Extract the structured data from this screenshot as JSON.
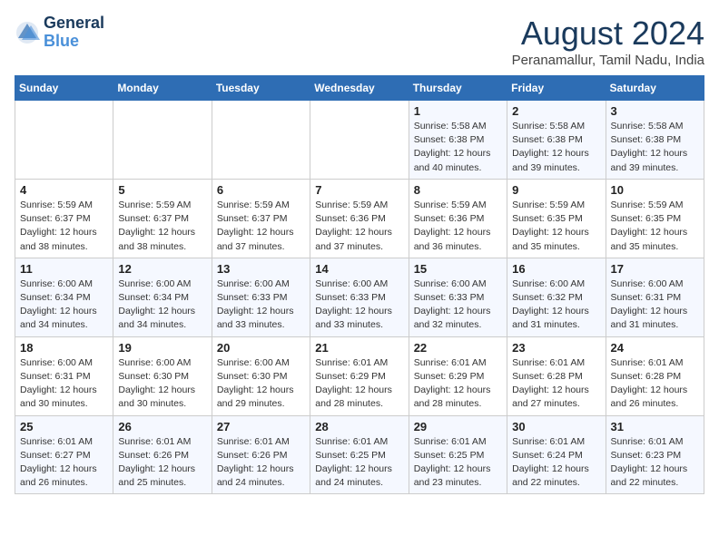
{
  "header": {
    "logo_line1": "General",
    "logo_line2": "Blue",
    "month_year": "August 2024",
    "location": "Peranamallur, Tamil Nadu, India"
  },
  "days_of_week": [
    "Sunday",
    "Monday",
    "Tuesday",
    "Wednesday",
    "Thursday",
    "Friday",
    "Saturday"
  ],
  "weeks": [
    [
      {
        "day": "",
        "info": ""
      },
      {
        "day": "",
        "info": ""
      },
      {
        "day": "",
        "info": ""
      },
      {
        "day": "",
        "info": ""
      },
      {
        "day": "1",
        "info": "Sunrise: 5:58 AM\nSunset: 6:38 PM\nDaylight: 12 hours\nand 40 minutes."
      },
      {
        "day": "2",
        "info": "Sunrise: 5:58 AM\nSunset: 6:38 PM\nDaylight: 12 hours\nand 39 minutes."
      },
      {
        "day": "3",
        "info": "Sunrise: 5:58 AM\nSunset: 6:38 PM\nDaylight: 12 hours\nand 39 minutes."
      }
    ],
    [
      {
        "day": "4",
        "info": "Sunrise: 5:59 AM\nSunset: 6:37 PM\nDaylight: 12 hours\nand 38 minutes."
      },
      {
        "day": "5",
        "info": "Sunrise: 5:59 AM\nSunset: 6:37 PM\nDaylight: 12 hours\nand 38 minutes."
      },
      {
        "day": "6",
        "info": "Sunrise: 5:59 AM\nSunset: 6:37 PM\nDaylight: 12 hours\nand 37 minutes."
      },
      {
        "day": "7",
        "info": "Sunrise: 5:59 AM\nSunset: 6:36 PM\nDaylight: 12 hours\nand 37 minutes."
      },
      {
        "day": "8",
        "info": "Sunrise: 5:59 AM\nSunset: 6:36 PM\nDaylight: 12 hours\nand 36 minutes."
      },
      {
        "day": "9",
        "info": "Sunrise: 5:59 AM\nSunset: 6:35 PM\nDaylight: 12 hours\nand 35 minutes."
      },
      {
        "day": "10",
        "info": "Sunrise: 5:59 AM\nSunset: 6:35 PM\nDaylight: 12 hours\nand 35 minutes."
      }
    ],
    [
      {
        "day": "11",
        "info": "Sunrise: 6:00 AM\nSunset: 6:34 PM\nDaylight: 12 hours\nand 34 minutes."
      },
      {
        "day": "12",
        "info": "Sunrise: 6:00 AM\nSunset: 6:34 PM\nDaylight: 12 hours\nand 34 minutes."
      },
      {
        "day": "13",
        "info": "Sunrise: 6:00 AM\nSunset: 6:33 PM\nDaylight: 12 hours\nand 33 minutes."
      },
      {
        "day": "14",
        "info": "Sunrise: 6:00 AM\nSunset: 6:33 PM\nDaylight: 12 hours\nand 33 minutes."
      },
      {
        "day": "15",
        "info": "Sunrise: 6:00 AM\nSunset: 6:33 PM\nDaylight: 12 hours\nand 32 minutes."
      },
      {
        "day": "16",
        "info": "Sunrise: 6:00 AM\nSunset: 6:32 PM\nDaylight: 12 hours\nand 31 minutes."
      },
      {
        "day": "17",
        "info": "Sunrise: 6:00 AM\nSunset: 6:31 PM\nDaylight: 12 hours\nand 31 minutes."
      }
    ],
    [
      {
        "day": "18",
        "info": "Sunrise: 6:00 AM\nSunset: 6:31 PM\nDaylight: 12 hours\nand 30 minutes."
      },
      {
        "day": "19",
        "info": "Sunrise: 6:00 AM\nSunset: 6:30 PM\nDaylight: 12 hours\nand 30 minutes."
      },
      {
        "day": "20",
        "info": "Sunrise: 6:00 AM\nSunset: 6:30 PM\nDaylight: 12 hours\nand 29 minutes."
      },
      {
        "day": "21",
        "info": "Sunrise: 6:01 AM\nSunset: 6:29 PM\nDaylight: 12 hours\nand 28 minutes."
      },
      {
        "day": "22",
        "info": "Sunrise: 6:01 AM\nSunset: 6:29 PM\nDaylight: 12 hours\nand 28 minutes."
      },
      {
        "day": "23",
        "info": "Sunrise: 6:01 AM\nSunset: 6:28 PM\nDaylight: 12 hours\nand 27 minutes."
      },
      {
        "day": "24",
        "info": "Sunrise: 6:01 AM\nSunset: 6:28 PM\nDaylight: 12 hours\nand 26 minutes."
      }
    ],
    [
      {
        "day": "25",
        "info": "Sunrise: 6:01 AM\nSunset: 6:27 PM\nDaylight: 12 hours\nand 26 minutes."
      },
      {
        "day": "26",
        "info": "Sunrise: 6:01 AM\nSunset: 6:26 PM\nDaylight: 12 hours\nand 25 minutes."
      },
      {
        "day": "27",
        "info": "Sunrise: 6:01 AM\nSunset: 6:26 PM\nDaylight: 12 hours\nand 24 minutes."
      },
      {
        "day": "28",
        "info": "Sunrise: 6:01 AM\nSunset: 6:25 PM\nDaylight: 12 hours\nand 24 minutes."
      },
      {
        "day": "29",
        "info": "Sunrise: 6:01 AM\nSunset: 6:25 PM\nDaylight: 12 hours\nand 23 minutes."
      },
      {
        "day": "30",
        "info": "Sunrise: 6:01 AM\nSunset: 6:24 PM\nDaylight: 12 hours\nand 22 minutes."
      },
      {
        "day": "31",
        "info": "Sunrise: 6:01 AM\nSunset: 6:23 PM\nDaylight: 12 hours\nand 22 minutes."
      }
    ]
  ]
}
